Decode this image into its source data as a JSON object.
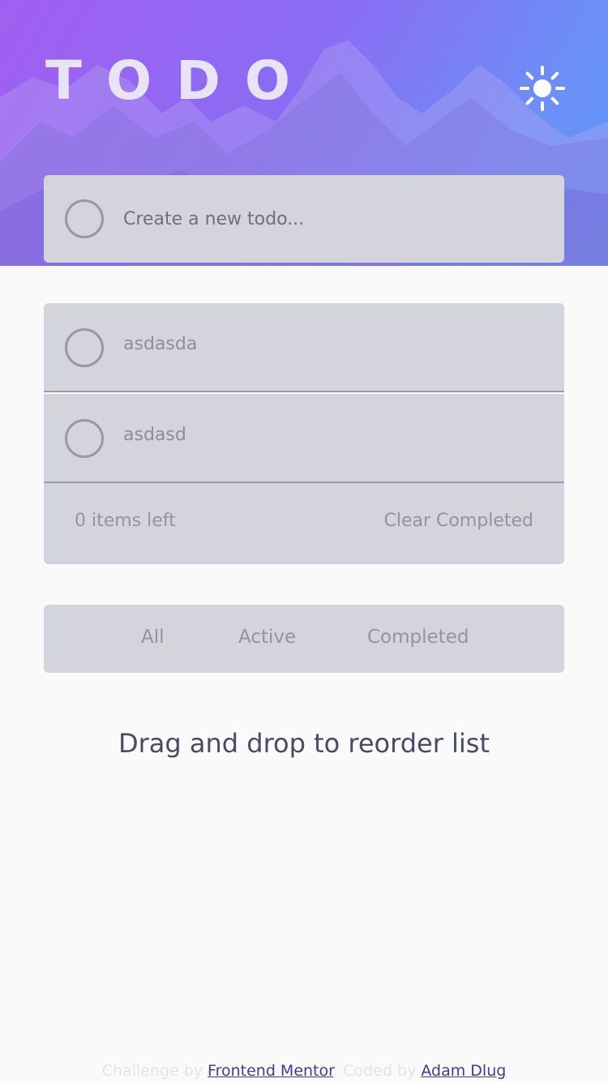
{
  "header": {
    "title": "TODO",
    "theme_icon": "sun-icon"
  },
  "create": {
    "placeholder": "Create a new todo...",
    "value": ""
  },
  "todos": [
    {
      "text": "asdasda",
      "completed": false
    },
    {
      "text": "asdasd",
      "completed": false
    }
  ],
  "list_footer": {
    "items_left": "0 items left",
    "clear_label": "Clear Completed"
  },
  "filters": {
    "all": "All",
    "active": "Active",
    "completed": "Completed"
  },
  "hint": "Drag and drop to reorder list",
  "attribution": {
    "prefix": "Challenge by ",
    "mentor_link": "Frontend Mentor",
    "middle": ". Coded by ",
    "author_link": "Adam Dlug"
  },
  "colors": {
    "gradient_start": "#a15ff0",
    "gradient_end": "#5b9af8",
    "card_background": "#d4d4dd",
    "page_background": "#fafafa"
  }
}
